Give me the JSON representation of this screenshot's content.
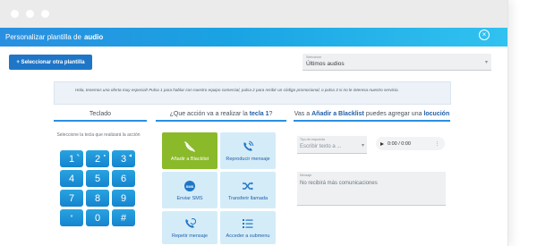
{
  "dialog": {
    "title_prefix": "Personalizar plantilla de",
    "title_emphasis": "audio",
    "close_glyph": "×"
  },
  "toolbar": {
    "select_template_label": "+ Seleccionar otra plantilla",
    "template_select": {
      "label": "Seleccione",
      "value": "Últimos audios"
    }
  },
  "info": {
    "text": "Hola, tenemos una oferta muy especial! Pulsa 1 para hablar con nuestro equipo comercial, pulsa 2 para recibir un código promocional, o pulsa 3 si no le interesa nuestro servicio."
  },
  "keyboard": {
    "heading": "Teclado",
    "hint": "Seleccione la tecla que realizará la acción",
    "keys": [
      {
        "label": "1",
        "badge": "✎"
      },
      {
        "label": "2",
        "badge": "●"
      },
      {
        "label": "3",
        "badge": "◀"
      },
      {
        "label": "4",
        "badge": ""
      },
      {
        "label": "5",
        "badge": ""
      },
      {
        "label": "6",
        "badge": ""
      },
      {
        "label": "7",
        "badge": ""
      },
      {
        "label": "8",
        "badge": ""
      },
      {
        "label": "9",
        "badge": ""
      },
      {
        "label": "*",
        "badge": ""
      },
      {
        "label": "0",
        "badge": ""
      },
      {
        "label": "#",
        "badge": ""
      }
    ]
  },
  "actions": {
    "heading_prefix": "¿Que acción va a realizar la",
    "heading_bold": "tecla 1",
    "heading_suffix": "?",
    "tiles": [
      {
        "label": "Añadir a Blacklist",
        "icon": "phone-blocked-icon",
        "active": true
      },
      {
        "label": "Reproducir mensaje",
        "icon": "phone-volume-icon",
        "active": false
      },
      {
        "label": "Enviar SMS",
        "icon": "sms-icon",
        "active": false
      },
      {
        "label": "Transferir llamada",
        "icon": "shuffle-icon",
        "active": false
      },
      {
        "label": "Repetir mensaje",
        "icon": "phone-repeat-icon",
        "active": false
      },
      {
        "label": "Acceder a submenu",
        "icon": "list-icon",
        "active": false
      }
    ]
  },
  "blacklist": {
    "heading_prefix": "Vas a",
    "heading_bold": "Añadir a Blacklist",
    "heading_middle": "puedes agregar una",
    "heading_bold2": "locución",
    "response_label": "Tipo de respuesta",
    "response_placeholder": "Escribir texto a ...",
    "audio_time": "0:00 / 0:00",
    "message_label": "Mensaje",
    "message_value": "No recibirá más comunicaciones"
  },
  "colors": {
    "accent": "#1f76c7",
    "active_tile": "#8aba2a",
    "tile_bg": "#d4ecf8",
    "key_bg": "#1684cf"
  }
}
